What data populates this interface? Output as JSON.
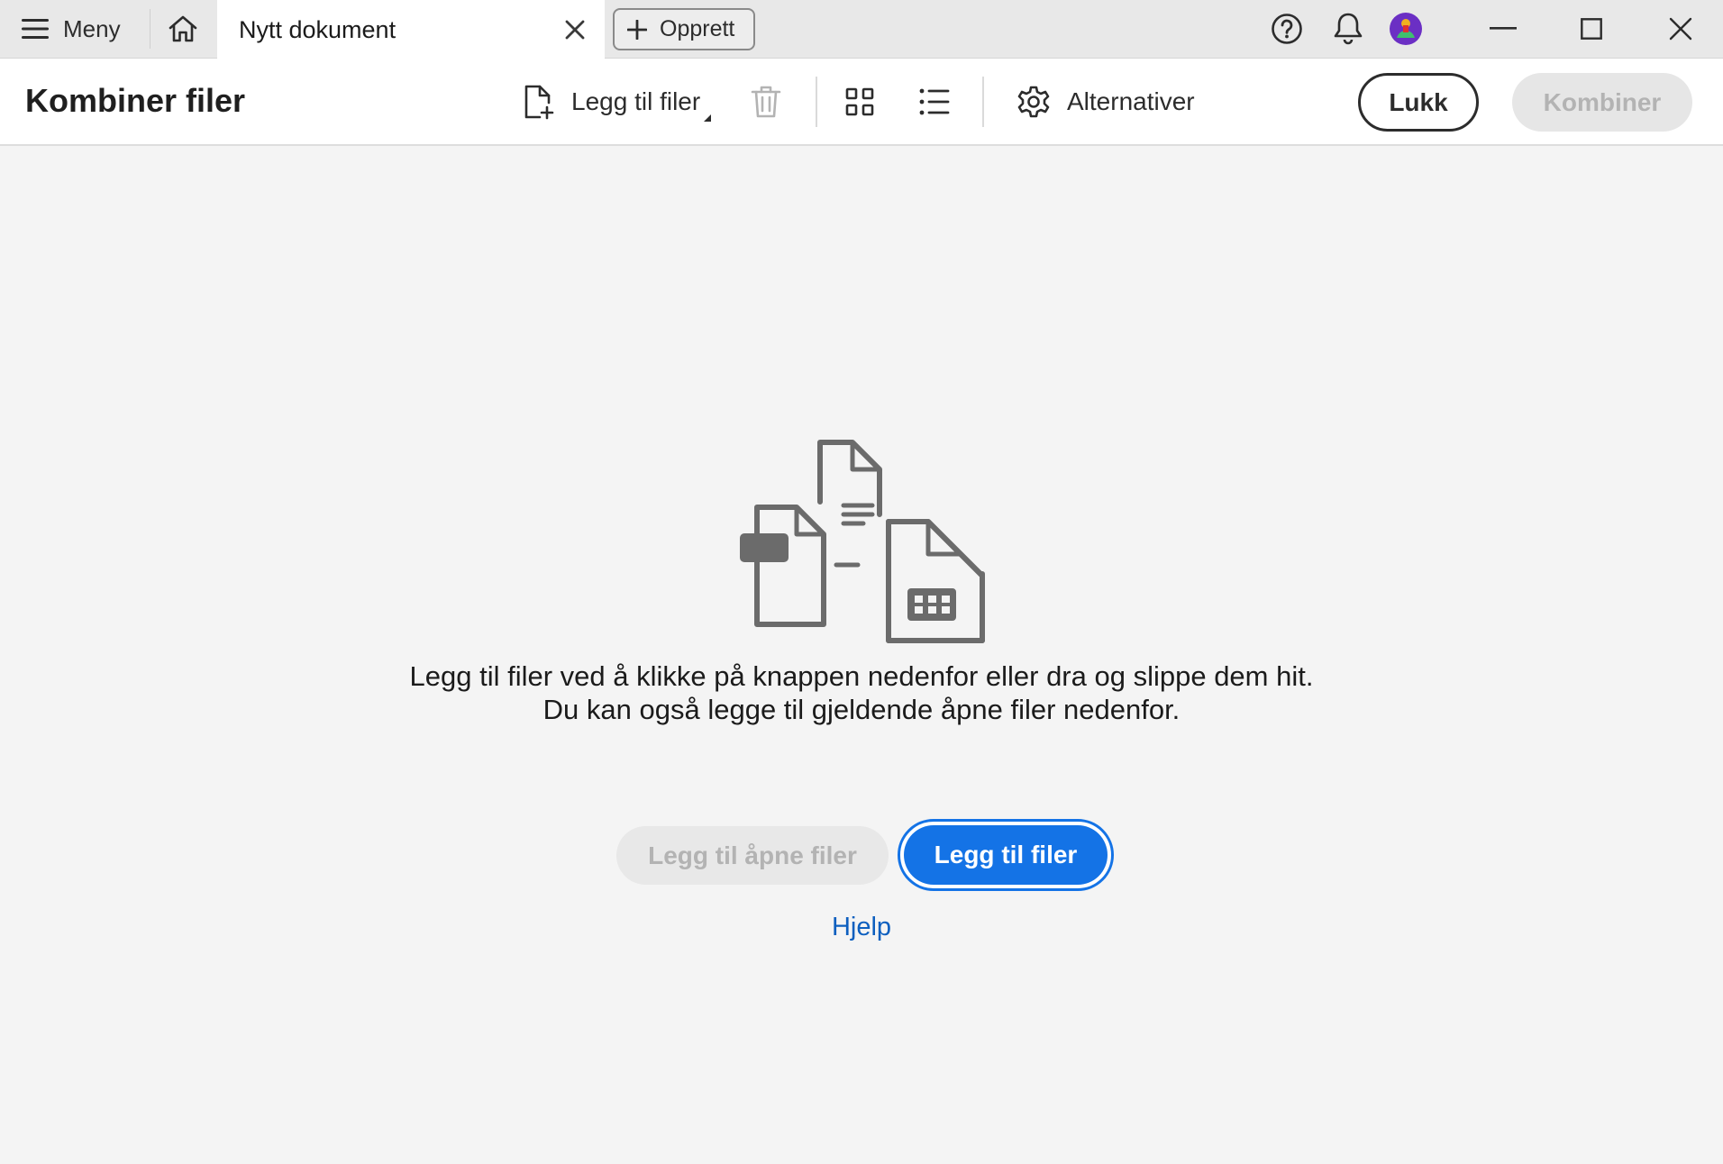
{
  "titlebar": {
    "menu_label": "Meny",
    "active_tab_label": "Nytt dokument",
    "create_label": "Opprett"
  },
  "toolbar": {
    "title": "Kombiner filer",
    "add_files_label": "Legg til filer",
    "options_label": "Alternativer",
    "close_label": "Lukk",
    "combine_label": "Kombiner"
  },
  "main": {
    "message_line1": "Legg til filer ved å klikke på knappen nedenfor eller dra og slippe dem hit.",
    "message_line2": "Du kan også legge til gjeldende åpne filer nedenfor.",
    "add_open_files_label": "Legg til åpne filer",
    "add_files_label": "Legg til filer",
    "help_label": "Hjelp"
  },
  "colors": {
    "accent": "#1473e6",
    "link": "#0d5fbf",
    "disabled_text": "#b3b3b3",
    "background": "#f4f4f4",
    "titlebar": "#e8e8e8"
  }
}
